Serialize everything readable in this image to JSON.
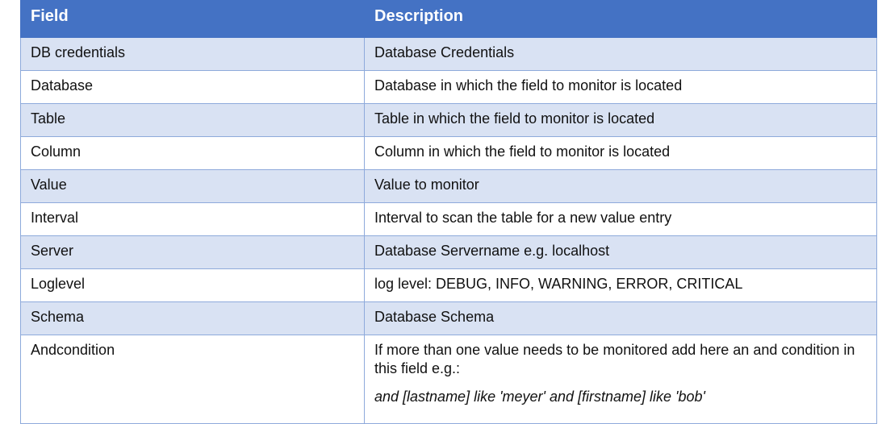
{
  "table": {
    "headers": [
      "Field",
      "Description"
    ],
    "rows": [
      {
        "field": "DB credentials",
        "description": "Database Credentials"
      },
      {
        "field": "Database",
        "description": "Database in which the field to monitor is located"
      },
      {
        "field": "Table",
        "description": "Table in which the field to monitor is located"
      },
      {
        "field": "Column",
        "description": "Column in which the field to monitor is located"
      },
      {
        "field": "Value",
        "description": "Value to monitor"
      },
      {
        "field": "Interval",
        "description": "Interval to scan the table for a new value entry"
      },
      {
        "field": "Server",
        "description": "Database Servername e.g. localhost"
      },
      {
        "field": "Loglevel",
        "description": "log level: DEBUG, INFO, WARNING, ERROR, CRITICAL"
      },
      {
        "field": "Schema",
        "description": "Database Schema"
      },
      {
        "field": "Andcondition",
        "description": "If more than one value needs to be monitored add here an and condition in this field e.g.:",
        "example": "and [lastname] like 'meyer' and [firstname] like 'bob'"
      }
    ]
  },
  "colors": {
    "header_bg": "#4472c4",
    "stripe_bg": "#d9e2f3",
    "border": "#8eaadb"
  }
}
